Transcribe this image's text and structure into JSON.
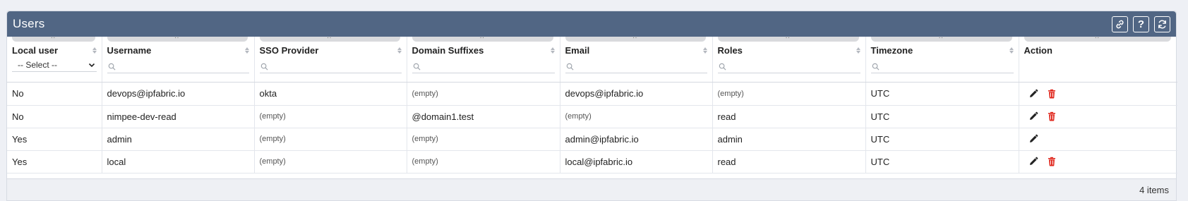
{
  "panel": {
    "title": "Users",
    "header_buttons": [
      {
        "name": "link-icon"
      },
      {
        "name": "help-icon",
        "label": "?"
      },
      {
        "name": "refresh-icon"
      }
    ]
  },
  "columns": [
    {
      "label": "Local user",
      "filter": "select",
      "select_value": "-- Select --"
    },
    {
      "label": "Username",
      "filter": "search",
      "placeholder": ""
    },
    {
      "label": "SSO Provider",
      "filter": "search",
      "placeholder": ""
    },
    {
      "label": "Domain Suffixes",
      "filter": "search",
      "placeholder": ""
    },
    {
      "label": "Email",
      "filter": "search",
      "placeholder": ""
    },
    {
      "label": "Roles",
      "filter": "search",
      "placeholder": ""
    },
    {
      "label": "Timezone",
      "filter": "search",
      "placeholder": ""
    },
    {
      "label": "Action"
    }
  ],
  "rows": [
    {
      "local_user": "No",
      "username": "devops@ipfabric.io",
      "sso_provider": "okta",
      "domain_suffixes": "(empty)",
      "email": "devops@ipfabric.io",
      "roles": "(empty)",
      "timezone": "UTC",
      "deletable": true
    },
    {
      "local_user": "No",
      "username": "nimpee-dev-read",
      "sso_provider": "(empty)",
      "domain_suffixes": "@domain1.test",
      "email": "(empty)",
      "roles": "read",
      "timezone": "UTC",
      "deletable": true
    },
    {
      "local_user": "Yes",
      "username": "admin",
      "sso_provider": "(empty)",
      "domain_suffixes": "(empty)",
      "email": "admin@ipfabric.io",
      "roles": "admin",
      "timezone": "UTC",
      "deletable": false
    },
    {
      "local_user": "Yes",
      "username": "local",
      "sso_provider": "(empty)",
      "domain_suffixes": "(empty)",
      "email": "local@ipfabric.io",
      "roles": "read",
      "timezone": "UTC",
      "deletable": true
    }
  ],
  "footer": {
    "count_text": "4 items"
  },
  "colors": {
    "header_bg": "#516684",
    "delete": "#e0281e",
    "edit": "#222222"
  }
}
